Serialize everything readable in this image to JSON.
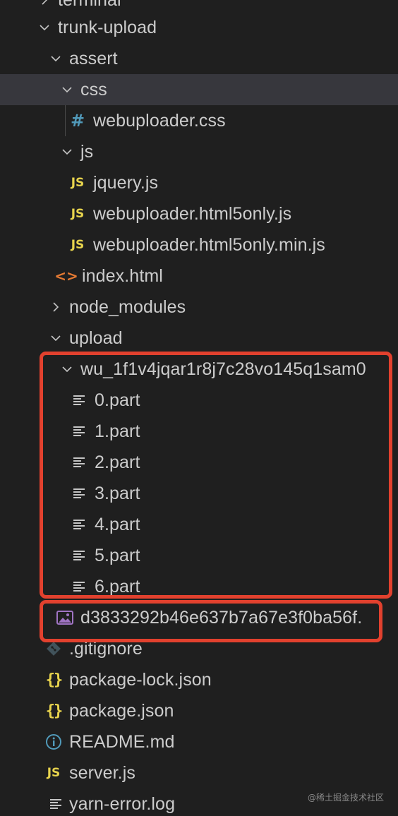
{
  "tree": {
    "items": [
      {
        "label": "terminal",
        "icon": "chevron-right-icon"
      },
      {
        "label": "trunk-upload",
        "icon": "chevron-down-icon"
      },
      {
        "label": "assert",
        "icon": "chevron-down-icon"
      },
      {
        "label": "css",
        "icon": "chevron-down-icon"
      },
      {
        "label": "webuploader.css",
        "icon": "css-file-icon",
        "glyph": "#"
      },
      {
        "label": "js",
        "icon": "chevron-down-icon"
      },
      {
        "label": "jquery.js",
        "icon": "js-file-icon",
        "glyph": "JS"
      },
      {
        "label": "webuploader.html5only.js",
        "icon": "js-file-icon",
        "glyph": "JS"
      },
      {
        "label": "webuploader.html5only.min.js",
        "icon": "js-file-icon",
        "glyph": "JS"
      },
      {
        "label": "index.html",
        "icon": "html-file-icon",
        "glyph": "<>"
      },
      {
        "label": "node_modules",
        "icon": "chevron-right-icon"
      },
      {
        "label": "upload",
        "icon": "chevron-down-icon"
      },
      {
        "label": "wu_1f1v4jqar1r8j7c28vo145q1sam0",
        "icon": "chevron-down-icon"
      },
      {
        "label": "0.part",
        "icon": "text-file-icon"
      },
      {
        "label": "1.part",
        "icon": "text-file-icon"
      },
      {
        "label": "2.part",
        "icon": "text-file-icon"
      },
      {
        "label": "3.part",
        "icon": "text-file-icon"
      },
      {
        "label": "4.part",
        "icon": "text-file-icon"
      },
      {
        "label": "5.part",
        "icon": "text-file-icon"
      },
      {
        "label": "6.part",
        "icon": "text-file-icon"
      },
      {
        "label": "d3833292b46e637b7a67e3f0ba56f.",
        "icon": "image-file-icon"
      },
      {
        "label": ".gitignore",
        "icon": "git-icon"
      },
      {
        "label": "package-lock.json",
        "icon": "json-file-icon",
        "glyph": "{}"
      },
      {
        "label": "package.json",
        "icon": "json-file-icon",
        "glyph": "{}"
      },
      {
        "label": "README.md",
        "icon": "info-icon"
      },
      {
        "label": "server.js",
        "icon": "js-file-icon",
        "glyph": "JS"
      },
      {
        "label": "yarn-error.log",
        "icon": "text-file-icon"
      }
    ]
  },
  "watermark": "@稀土掘金技术社区",
  "colors": {
    "background": "#1f1f1f",
    "selected_row": "#37373d",
    "highlight_box": "#e2412e",
    "js_icon": "#e8d44d",
    "css_icon": "#519aba",
    "html_icon": "#e37933"
  }
}
